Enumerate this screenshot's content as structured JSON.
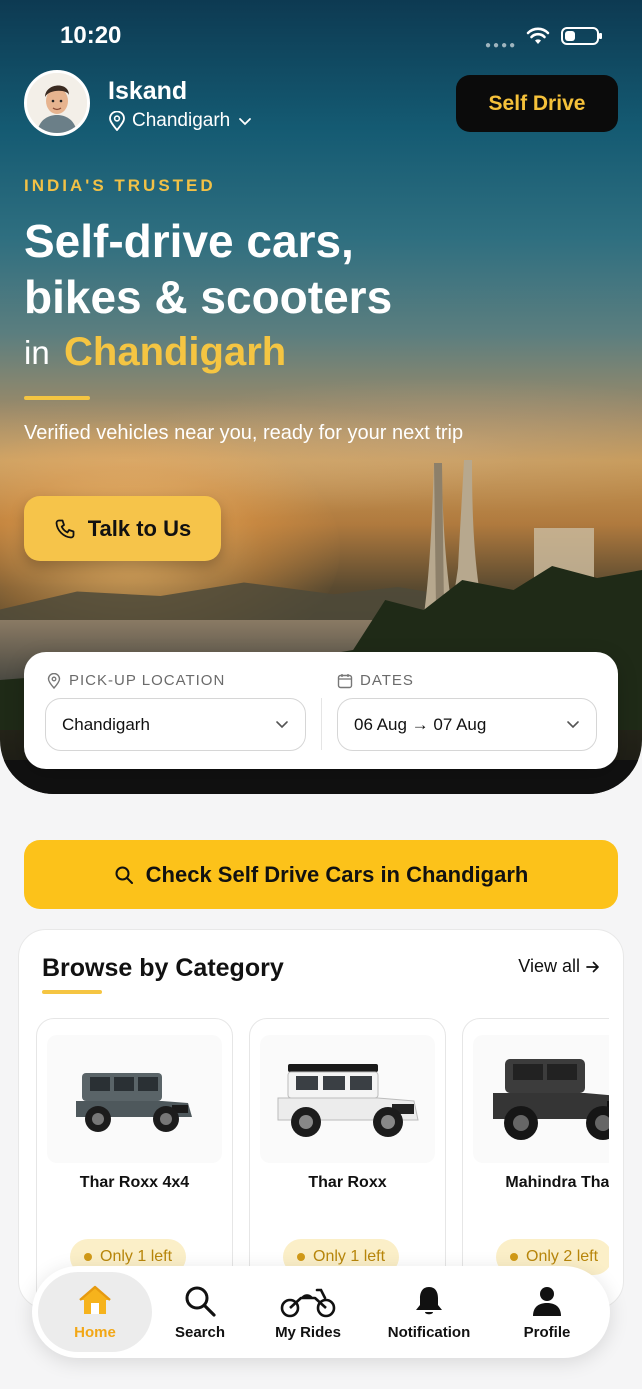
{
  "status": {
    "time": "10:20"
  },
  "user": {
    "name": "Iskand",
    "city": "Chandigarh"
  },
  "header": {
    "mode_button": "Self Drive"
  },
  "hero": {
    "eyebrow": "INDIA'S TRUSTED",
    "headline_line1": "Self-drive cars,",
    "headline_line2": "bikes & scooters",
    "headline_in": "in",
    "headline_city": "Chandigarh",
    "subtext": "Verified vehicles near you, ready for your next trip",
    "talk_button": "Talk to Us"
  },
  "search": {
    "pickup_label": "PICK-UP LOCATION",
    "pickup_value": "Chandigarh",
    "dates_label": "DATES",
    "dates_value": "06 Aug → 07 Aug",
    "check_button": "Check Self Drive Cars in Chandigarh"
  },
  "categories": {
    "title": "Browse by Category",
    "view_all": "View all",
    "items": [
      {
        "name": "Thar Roxx 4x4",
        "stock": "Only 1 left",
        "color": "#5a6468"
      },
      {
        "name": "Thar Roxx",
        "stock": "Only 1 left",
        "color": "#f4f4f4"
      },
      {
        "name": "Mahindra Thar",
        "stock": "Only 2 left",
        "color": "#3c3c3c"
      }
    ]
  },
  "nav": {
    "items": [
      {
        "label": "Home",
        "icon": "home-icon",
        "active": true
      },
      {
        "label": "Search",
        "icon": "search-icon"
      },
      {
        "label": "My Rides",
        "icon": "motorcycle-icon"
      },
      {
        "label": "Notification",
        "icon": "bell-icon"
      },
      {
        "label": "Profile",
        "icon": "person-icon"
      }
    ]
  },
  "colors": {
    "accent": "#fcc21a",
    "accent_text": "#f5c542",
    "dark": "#0b0b0b"
  }
}
